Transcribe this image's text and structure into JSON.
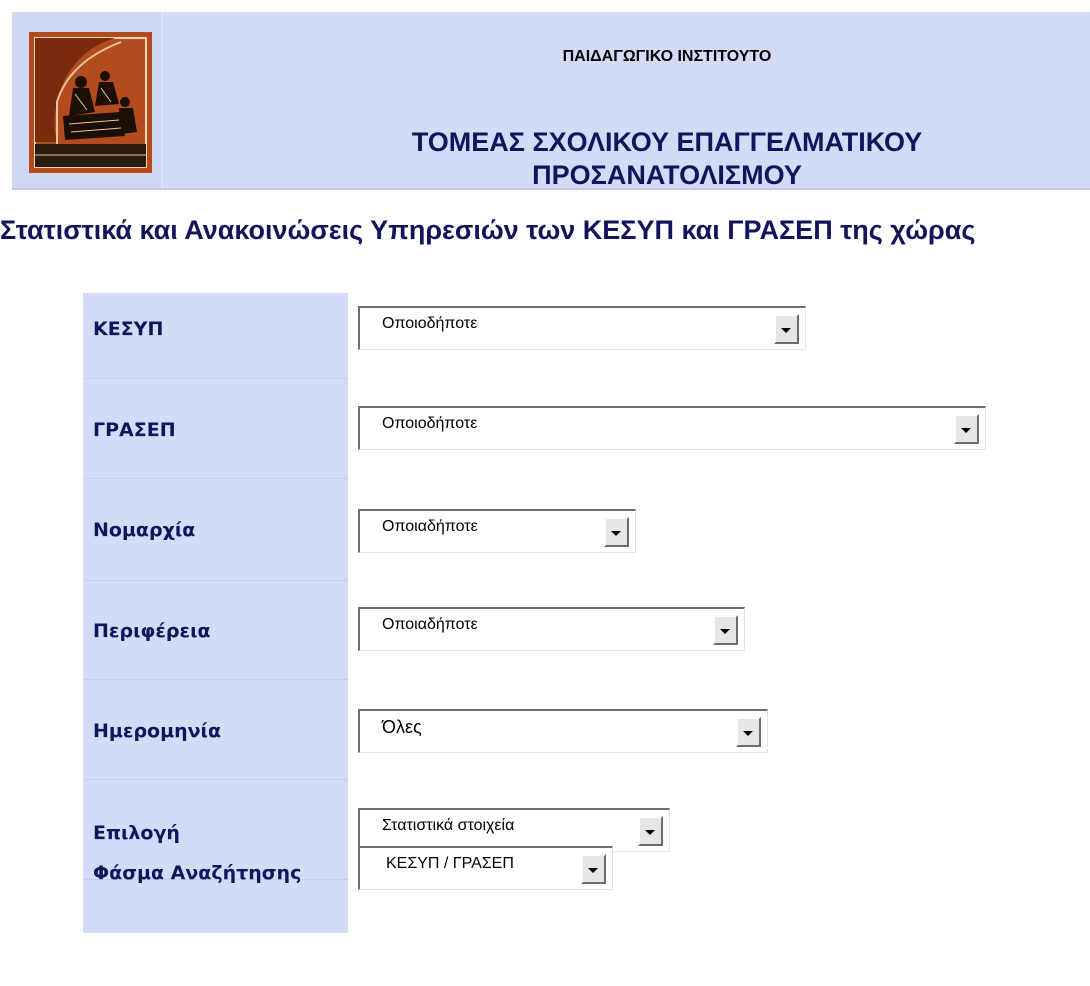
{
  "header": {
    "logo_text": "ΠΑΙΔΑΓΩΓΙΚΟ ΙΝΣΤΙΤΟΥΤΟ",
    "institute": "ΠΑΙΔΑΓΩΓΙΚΟ ΙΝΣΤΙΤΟΥΤΟ",
    "department_line1": "ΤΟΜΕΑΣ ΣΧΟΛΙΚΟΥ ΕΠΑΓΓΕΛΜΑΤΙΚΟΥ",
    "department_line2": "ΠΡΟΣΑΝΑΤΟΛΙΣΜΟΥ"
  },
  "page_heading": "Στατιστικά και Ανακοινώσεις Υπηρεσιών των ΚΕΣΥΠ και ΓΡΑΣΕΠ της χώρας",
  "form": {
    "fields": [
      {
        "label": "ΚΕΣΥΠ",
        "value": "Οποιοδήποτε"
      },
      {
        "label": "ΓΡΑΣΕΠ",
        "value": "Οποιοδήποτε"
      },
      {
        "label": "Νομαρχία",
        "value": "Οποιαδήποτε"
      },
      {
        "label": "Περιφέρεια",
        "value": "Οποιαδήποτε"
      },
      {
        "label": "Ημερομηνία",
        "value": "Όλες"
      },
      {
        "label": "Επιλογή",
        "value": "Στατιστικά στοιχεία"
      },
      {
        "label": "Φάσμα Αναζήτησης",
        "value": "ΚΕΣΥΠ / ΓΡΑΣΕΠ"
      }
    ]
  },
  "colors": {
    "banner_bg": "#d3dbf6",
    "heading_text": "#14145c",
    "logo_bg": "#b34b1e"
  },
  "icons": {
    "logo": "ancient-greek-vase-scene-logo",
    "dropdown": "chevron-down-icon"
  }
}
